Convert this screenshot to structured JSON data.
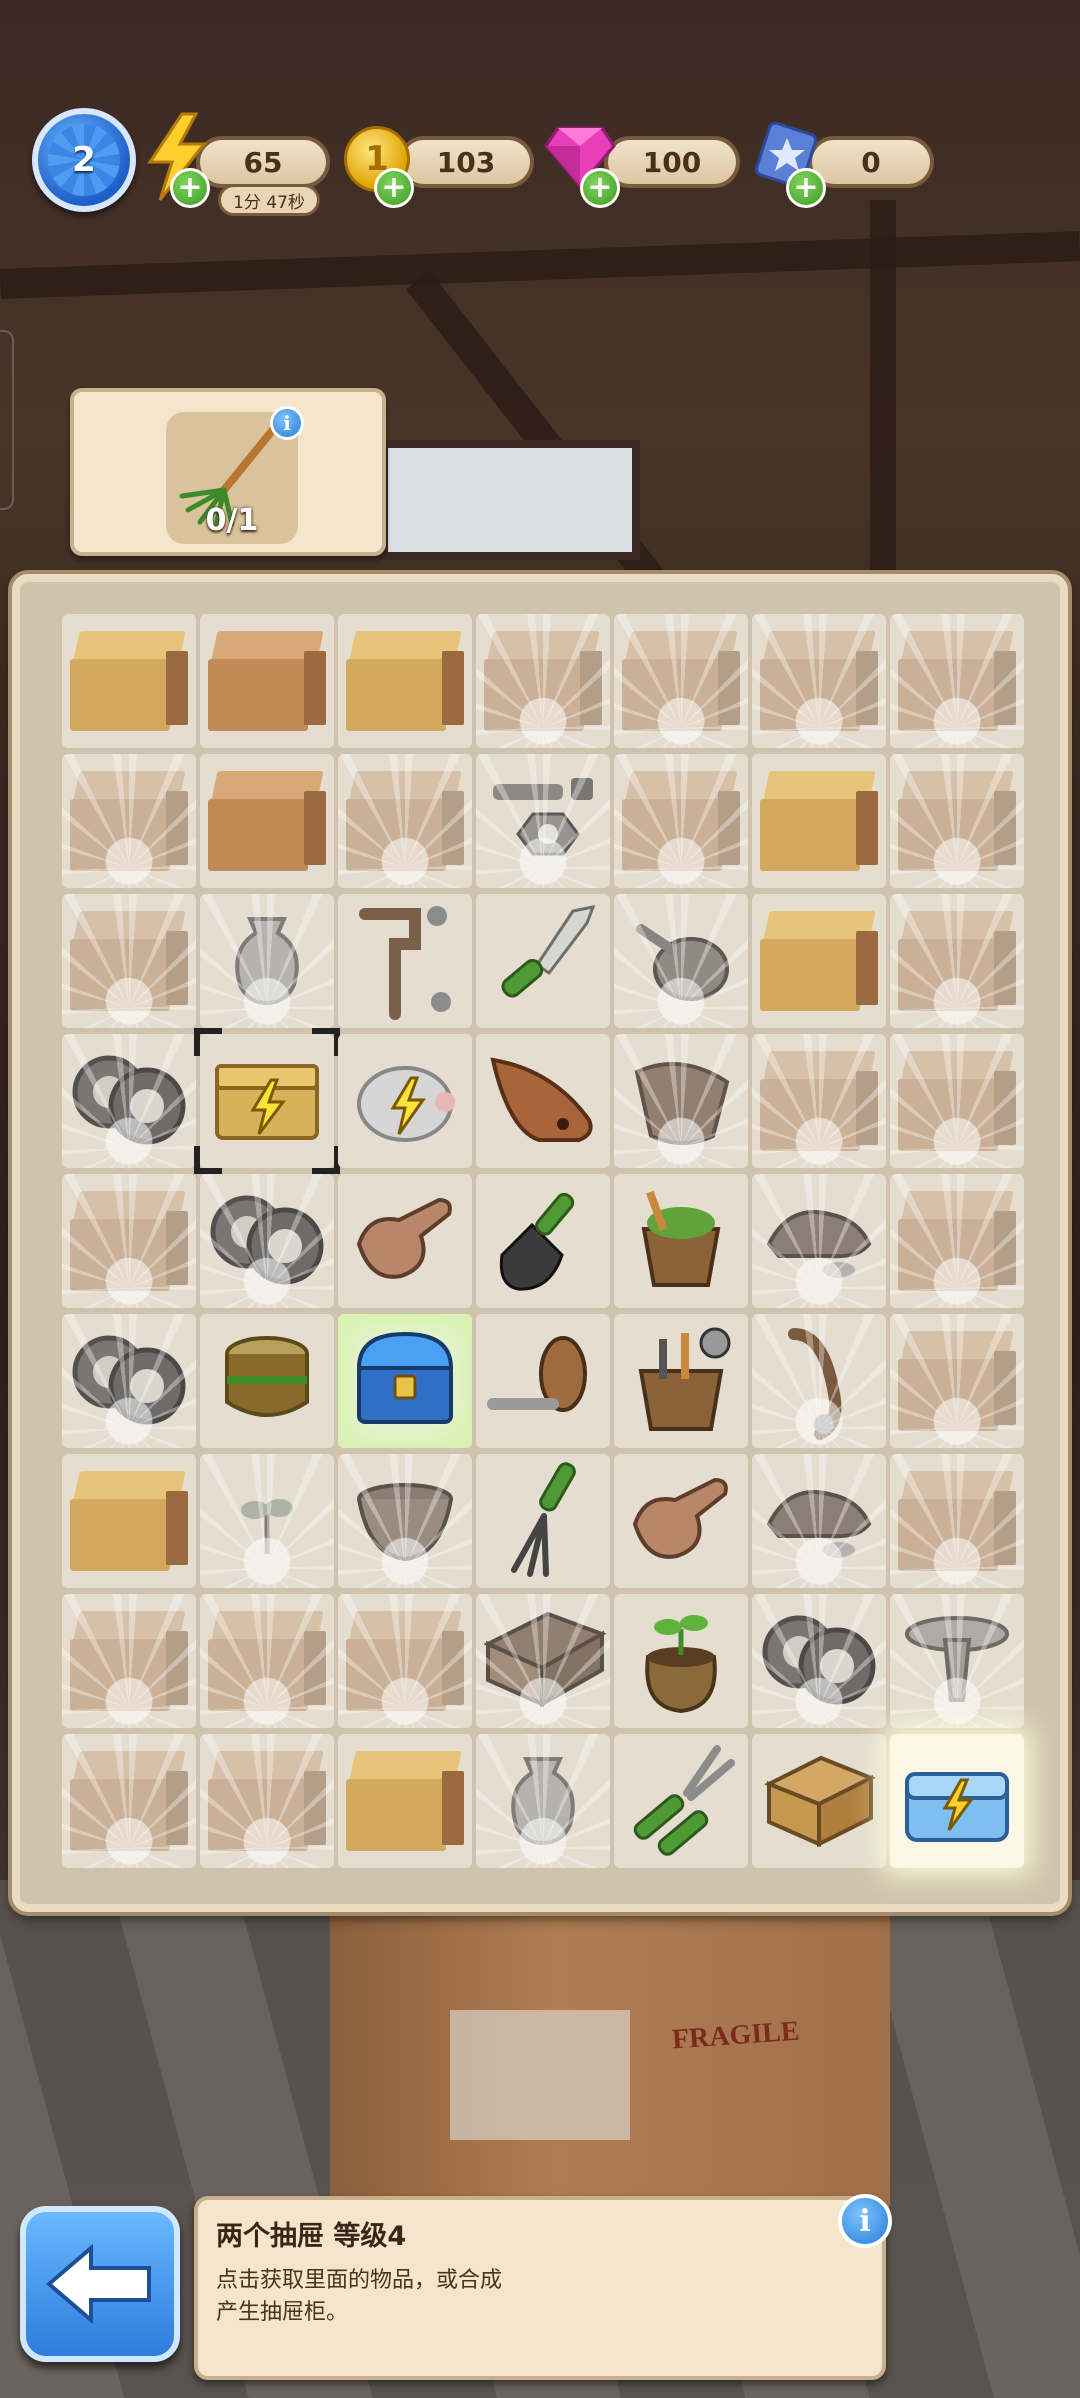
{
  "hud": {
    "level": "2",
    "energy": "65",
    "energy_timer": "1分 47秒",
    "coins": "103",
    "gems": "100",
    "cards": "0"
  },
  "goal": {
    "item_icon": "rake-icon",
    "progress": "0/1"
  },
  "board": {
    "rows": [
      [
        "box-yellow",
        "box",
        "box-yellow",
        "box-faded",
        "box-faded",
        "box-faded",
        "box-faded"
      ],
      [
        "box-faded",
        "box",
        "box-faded",
        "bolts-nuts",
        "box-faded",
        "box-yellow",
        "box-faded"
      ],
      [
        "box-faded",
        "vase",
        "faucet-pipe",
        "knife",
        "screw-lid",
        "box-yellow",
        "box-faded"
      ],
      [
        "tires",
        "energy-chest",
        "energy-piggy",
        "clay-lamp",
        "clay-pot-broken",
        "box-faded",
        "box-faded"
      ],
      [
        "box-faded",
        "tires",
        "gloves",
        "trowel",
        "bucket-plant",
        "shoes",
        "box-faded"
      ],
      [
        "tires",
        "wooden-barrel",
        "blue-chest",
        "screw-hook",
        "tool-bucket",
        "door-handle",
        "box-faded"
      ],
      [
        "box-yellow",
        "sprout",
        "bowl",
        "hand-fork",
        "gloves",
        "shoes",
        "box-faded"
      ],
      [
        "box-faded",
        "box-faded",
        "box-faded",
        "wood-drawer",
        "potted-plant",
        "tires",
        "birdbath"
      ],
      [
        "box-faded",
        "box-faded",
        "box-yellow",
        "vase",
        "pruning-shears",
        "wooden-crate",
        "energy-toolbox"
      ]
    ]
  },
  "info_panel": {
    "title": "两个抽屉 等级4",
    "description": "点击获取里面的物品，或合成产生抽屉柜。"
  },
  "colors": {
    "accent_blue": "#2c7ddc",
    "plus_green": "#3e9b27",
    "panel_cream": "#f3e6cd"
  }
}
